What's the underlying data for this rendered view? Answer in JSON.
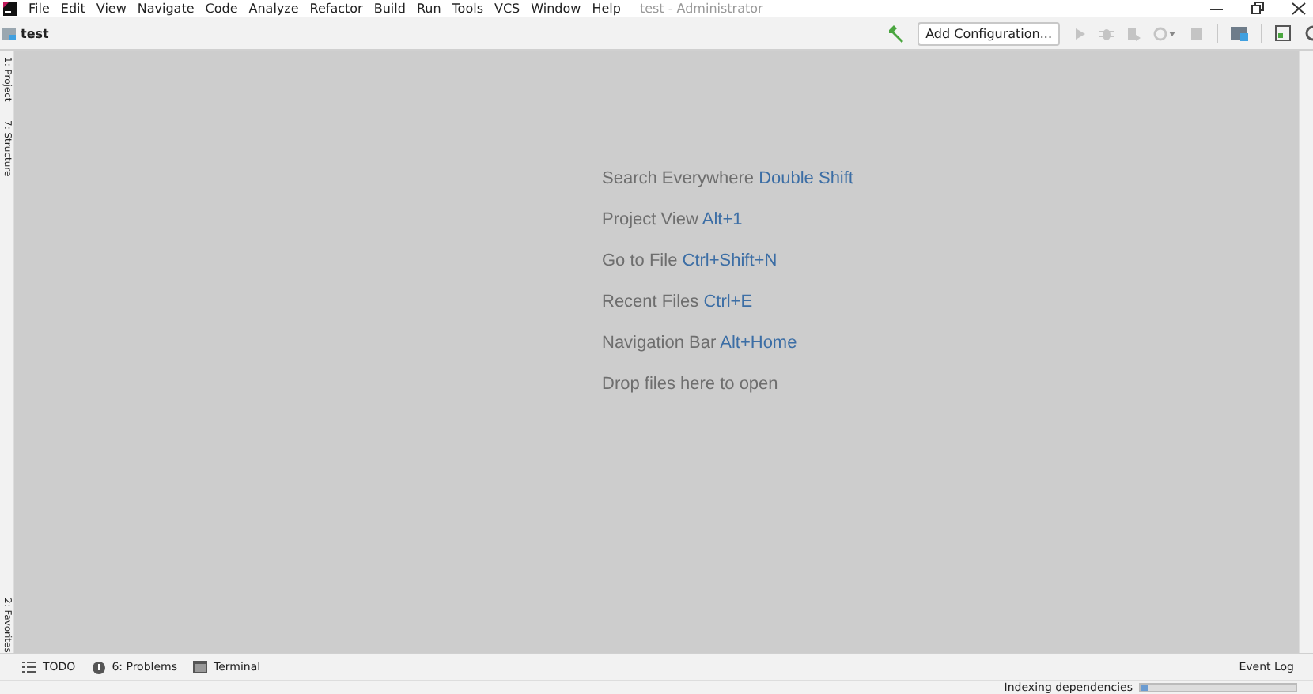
{
  "window": {
    "title": "test - Administrator"
  },
  "menu": [
    "File",
    "Edit",
    "View",
    "Navigate",
    "Code",
    "Analyze",
    "Refactor",
    "Build",
    "Run",
    "Tools",
    "VCS",
    "Window",
    "Help"
  ],
  "navbar": {
    "project": "test",
    "run_config": "Add Configuration..."
  },
  "left_strip": [
    {
      "label": "1: Project",
      "selected": false
    },
    {
      "label": "7: Structure",
      "selected": false
    },
    {
      "label": "2: Favorites",
      "selected": false
    }
  ],
  "hints": [
    {
      "text": "Search Everywhere",
      "shortcut": "Double Shift"
    },
    {
      "text": "Project View",
      "shortcut": "Alt+1"
    },
    {
      "text": "Go to File",
      "shortcut": "Ctrl+Shift+N"
    },
    {
      "text": "Recent Files",
      "shortcut": "Ctrl+E"
    },
    {
      "text": "Navigation Bar",
      "shortcut": "Alt+Home"
    },
    {
      "text": "Drop files here to open"
    }
  ],
  "bottom_tabs": [
    {
      "label": "TODO",
      "kind": "list"
    },
    {
      "label": "6: Problems",
      "kind": "info"
    },
    {
      "label": "Terminal",
      "kind": "terminal"
    }
  ],
  "event_log": "Event Log",
  "status_bar": {
    "task": "Indexing dependencies",
    "level": 0.05
  }
}
